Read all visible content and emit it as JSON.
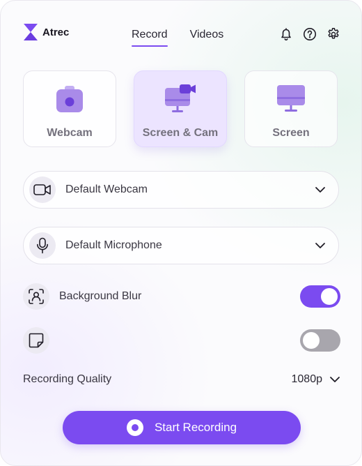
{
  "app": {
    "name": "Atrec"
  },
  "nav": {
    "tabs": [
      {
        "label": "Record",
        "active": true
      },
      {
        "label": "Videos",
        "active": false
      }
    ]
  },
  "header_icons": [
    "bell-icon",
    "help-icon",
    "gear-icon"
  ],
  "modes": [
    {
      "label": "Webcam",
      "icon": "webcam-icon",
      "active": false
    },
    {
      "label": "Screen & Cam",
      "icon": "screen-cam-icon",
      "active": true
    },
    {
      "label": "Screen",
      "icon": "screen-icon",
      "active": false
    }
  ],
  "camera_select": {
    "value": "Default Webcam",
    "icon": "video-camera-icon"
  },
  "mic_select": {
    "value": "Default Microphone",
    "icon": "microphone-icon"
  },
  "background_blur": {
    "label": "Background Blur",
    "enabled": true,
    "icon": "person-frame-icon"
  },
  "notes": {
    "label": "",
    "enabled": false,
    "icon": "sticky-note-icon"
  },
  "quality": {
    "label": "Recording Quality",
    "value": "1080p"
  },
  "start_button": {
    "label": "Start Recording"
  },
  "colors": {
    "accent": "#7b4bf0",
    "accent_light": "#ece4ff",
    "icon_purple": "#a98be9",
    "toggle_off": "#a8a6ad"
  }
}
